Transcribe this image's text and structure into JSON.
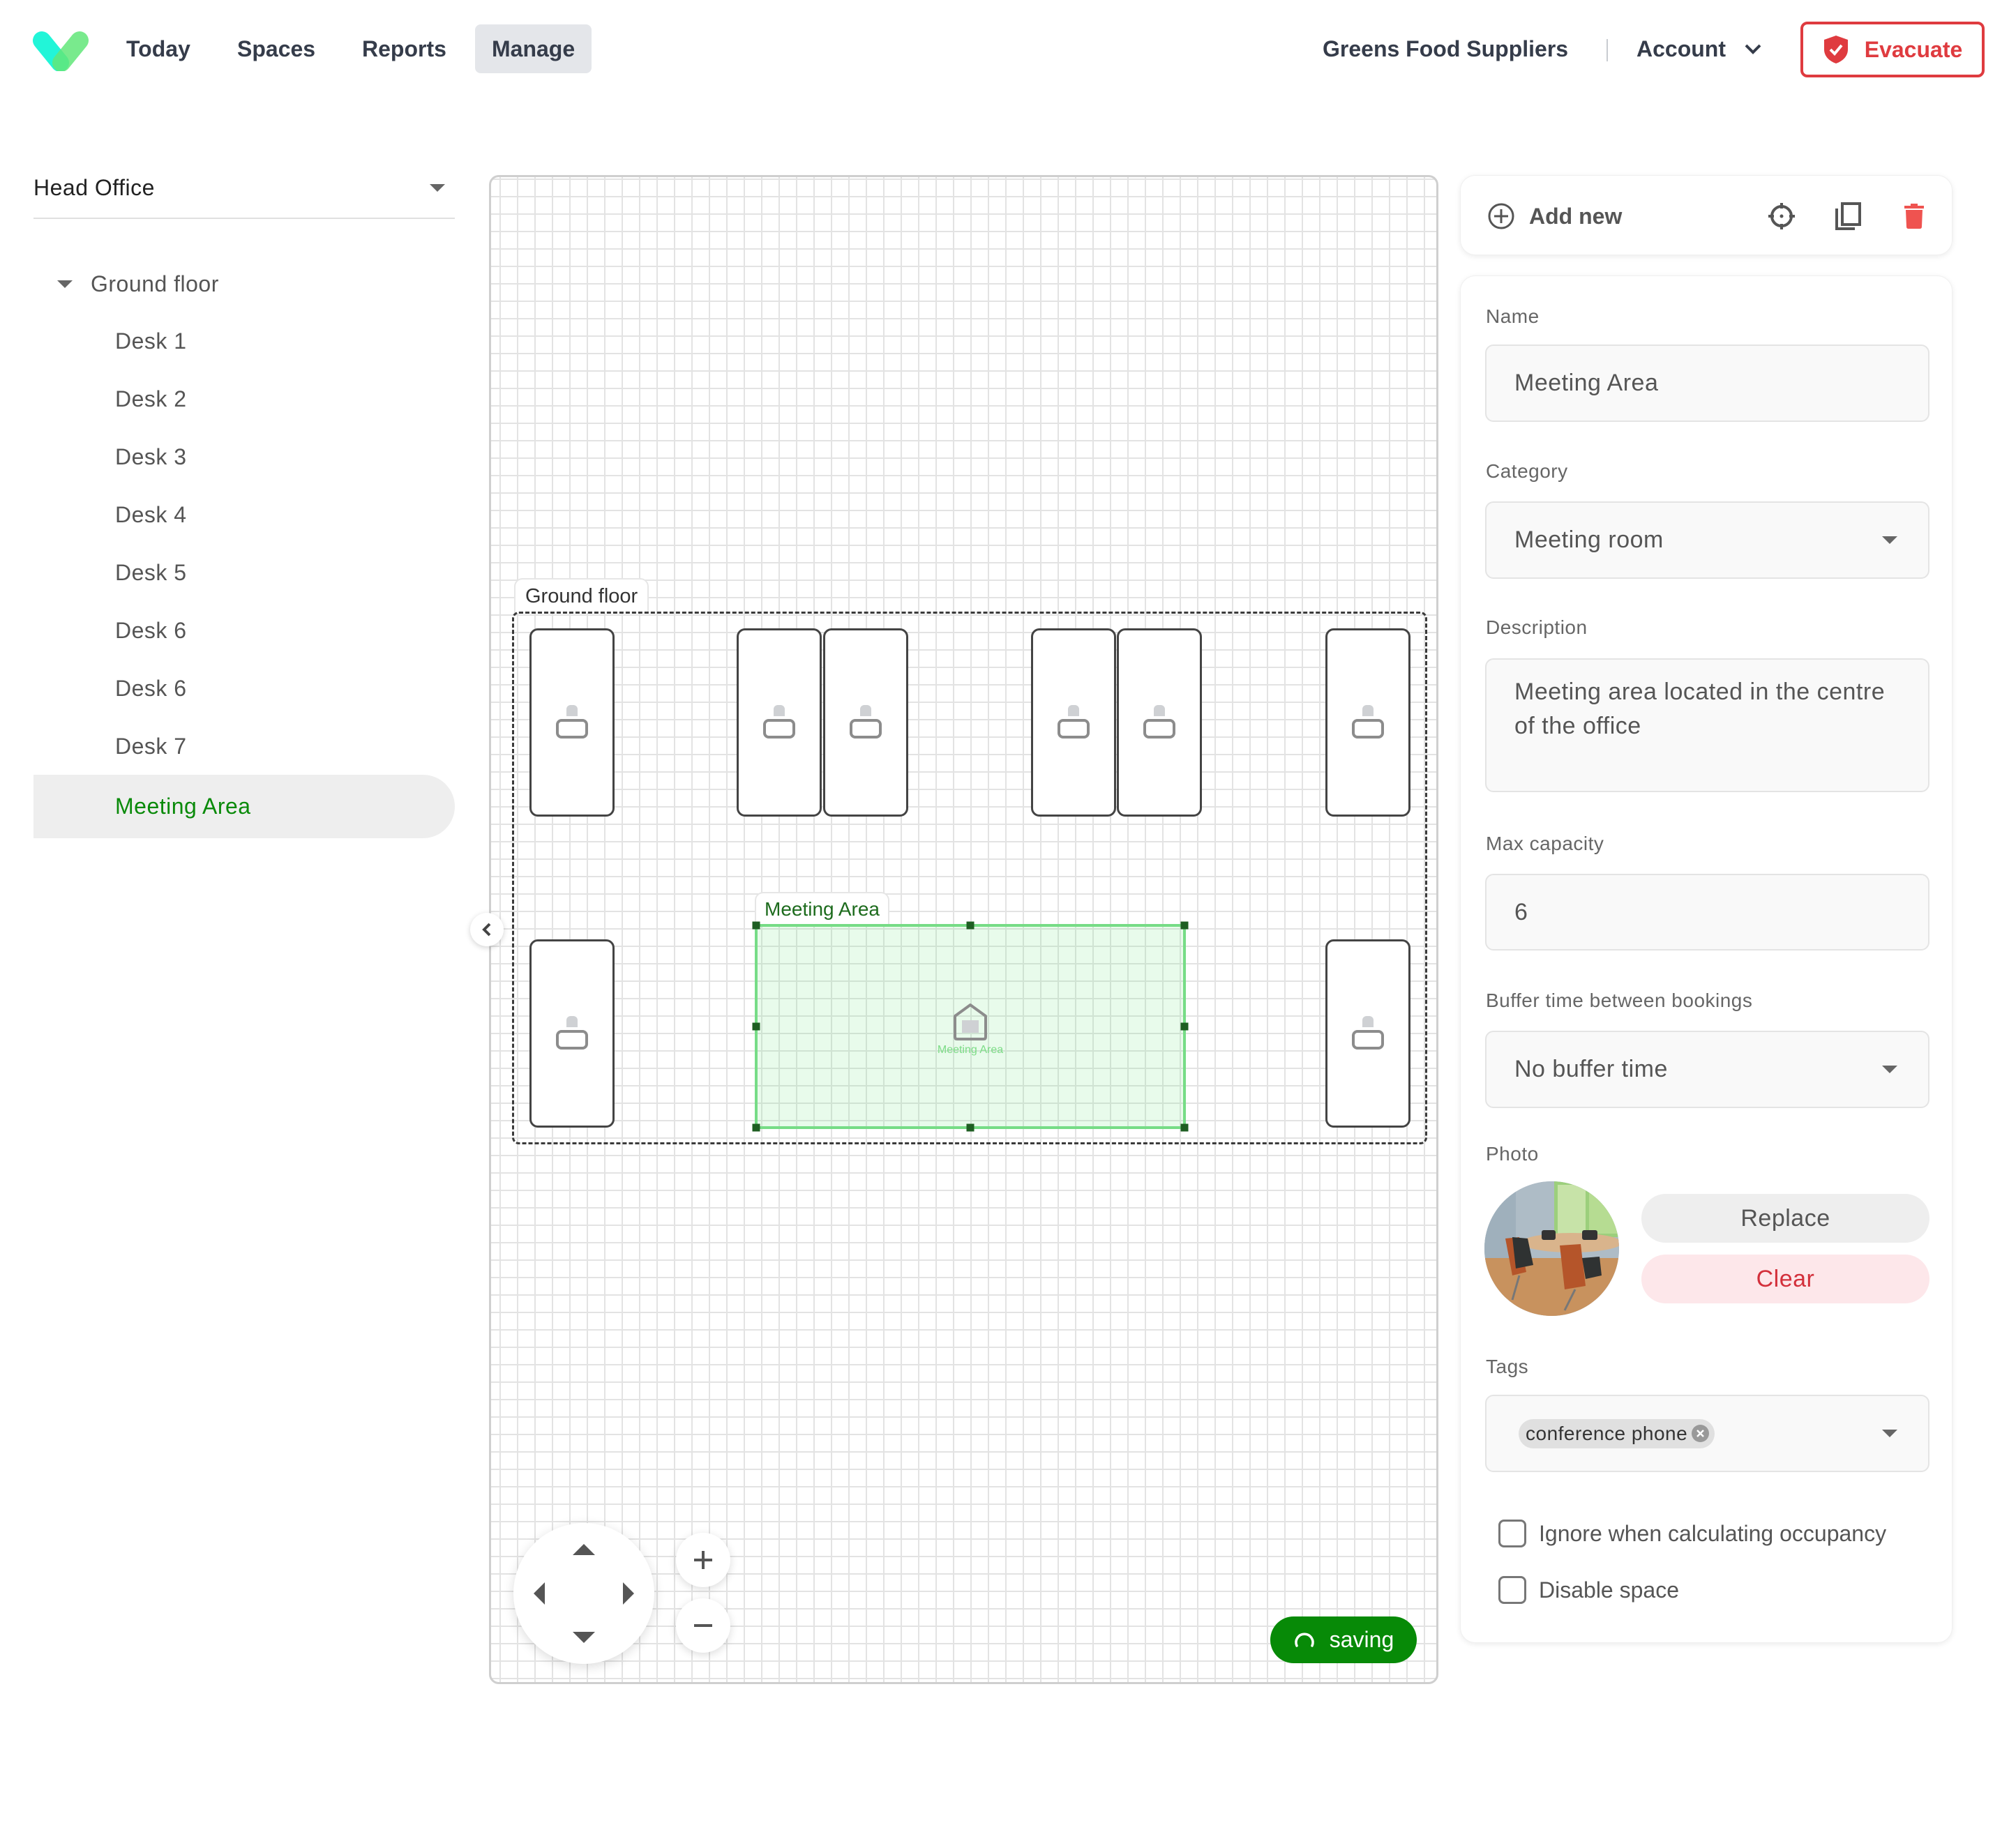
{
  "header": {
    "logo": "app-logo",
    "nav": [
      {
        "label": "Today",
        "active": false
      },
      {
        "label": "Spaces",
        "active": false
      },
      {
        "label": "Reports",
        "active": false
      },
      {
        "label": "Manage",
        "active": true
      }
    ],
    "organization": "Greens Food Suppliers",
    "account_label": "Account",
    "evacuate_label": "Evacuate",
    "colors": {
      "evacuate": "#df3b3f",
      "nav_active_bg": "#e4e6ea"
    }
  },
  "sidebar": {
    "site_selector": "Head Office",
    "floor": {
      "label": "Ground floor",
      "expanded": true
    },
    "items": [
      {
        "label": "Desk 1",
        "selected": false
      },
      {
        "label": "Desk 2",
        "selected": false
      },
      {
        "label": "Desk 3",
        "selected": false
      },
      {
        "label": "Desk 4",
        "selected": false
      },
      {
        "label": "Desk 5",
        "selected": false
      },
      {
        "label": "Desk 6",
        "selected": false
      },
      {
        "label": "Desk 6",
        "selected": false
      },
      {
        "label": "Desk 7",
        "selected": false
      },
      {
        "label": "Meeting Area",
        "selected": true
      }
    ],
    "colors": {
      "selected_text": "#0a8a0a",
      "selected_bg": "#eeeeee"
    }
  },
  "canvas": {
    "floor_label": "Ground floor",
    "desk_count": 9,
    "meeting_area": {
      "label": "Meeting Area",
      "caption": "Meeting Area",
      "selected": true
    },
    "status": "saving",
    "colors": {
      "status_bg": "#078a07",
      "meeting_fill": "#e6f8e9",
      "meeting_border": "#76dc86"
    }
  },
  "toolbar": {
    "add_new_label": "Add new",
    "icons": [
      "plus-circle-icon",
      "crosshair-icon",
      "duplicate-icon",
      "trash-icon"
    ]
  },
  "form": {
    "name": {
      "label": "Name",
      "value": "Meeting Area"
    },
    "category": {
      "label": "Category",
      "value": "Meeting room"
    },
    "description": {
      "label": "Description",
      "value": "Meeting area located in the centre of the office"
    },
    "max_capacity": {
      "label": "Max capacity",
      "value": "6"
    },
    "buffer_time": {
      "label": "Buffer time between bookings",
      "value": "No buffer time"
    },
    "photo": {
      "label": "Photo",
      "replace_label": "Replace",
      "clear_label": "Clear"
    },
    "tags": {
      "label": "Tags",
      "values": [
        "conference phone"
      ]
    },
    "ignore_occupancy": {
      "label": "Ignore when calculating occupancy",
      "checked": false
    },
    "disable_space": {
      "label": "Disable space",
      "checked": false
    }
  }
}
